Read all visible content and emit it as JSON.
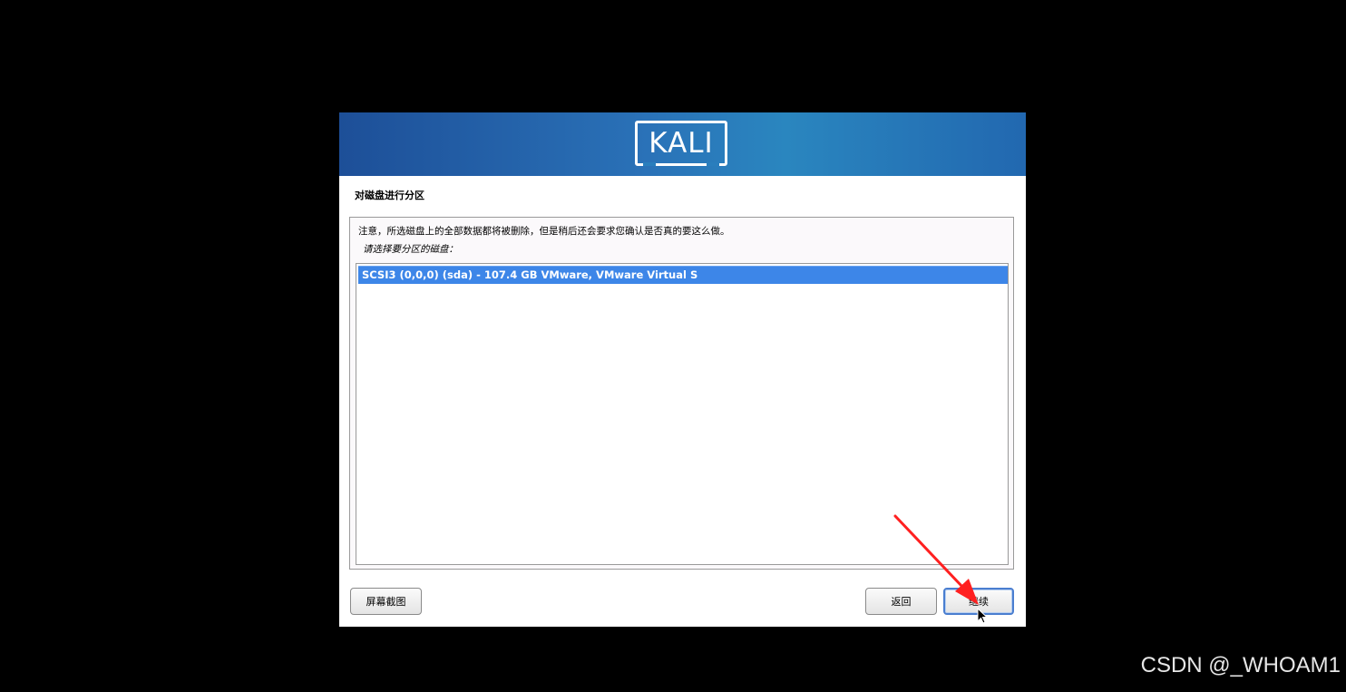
{
  "installer": {
    "logo_text": "KALI",
    "page_title": "对磁盘进行分区",
    "note": "注意，所选磁盘上的全部数据都将被删除，但是稍后还会要求您确认是否真的要这么做。",
    "prompt": "请选择要分区的磁盘：",
    "disks": [
      {
        "label": "SCSI3 (0,0,0) (sda) - 107.4 GB VMware, VMware Virtual S",
        "selected": true
      }
    ],
    "buttons": {
      "screenshot": "屏幕截图",
      "back": "返回",
      "continue": "继续"
    }
  },
  "colors": {
    "selection": "#3d86e8",
    "banner_start": "#1d4f98",
    "banner_end": "#2a86bf",
    "annotation_arrow": "#ff2020"
  },
  "icons": {
    "annotation": "red-arrow-icon",
    "cursor": "mouse-pointer-icon"
  },
  "watermark": "CSDN @_WHOAM1"
}
